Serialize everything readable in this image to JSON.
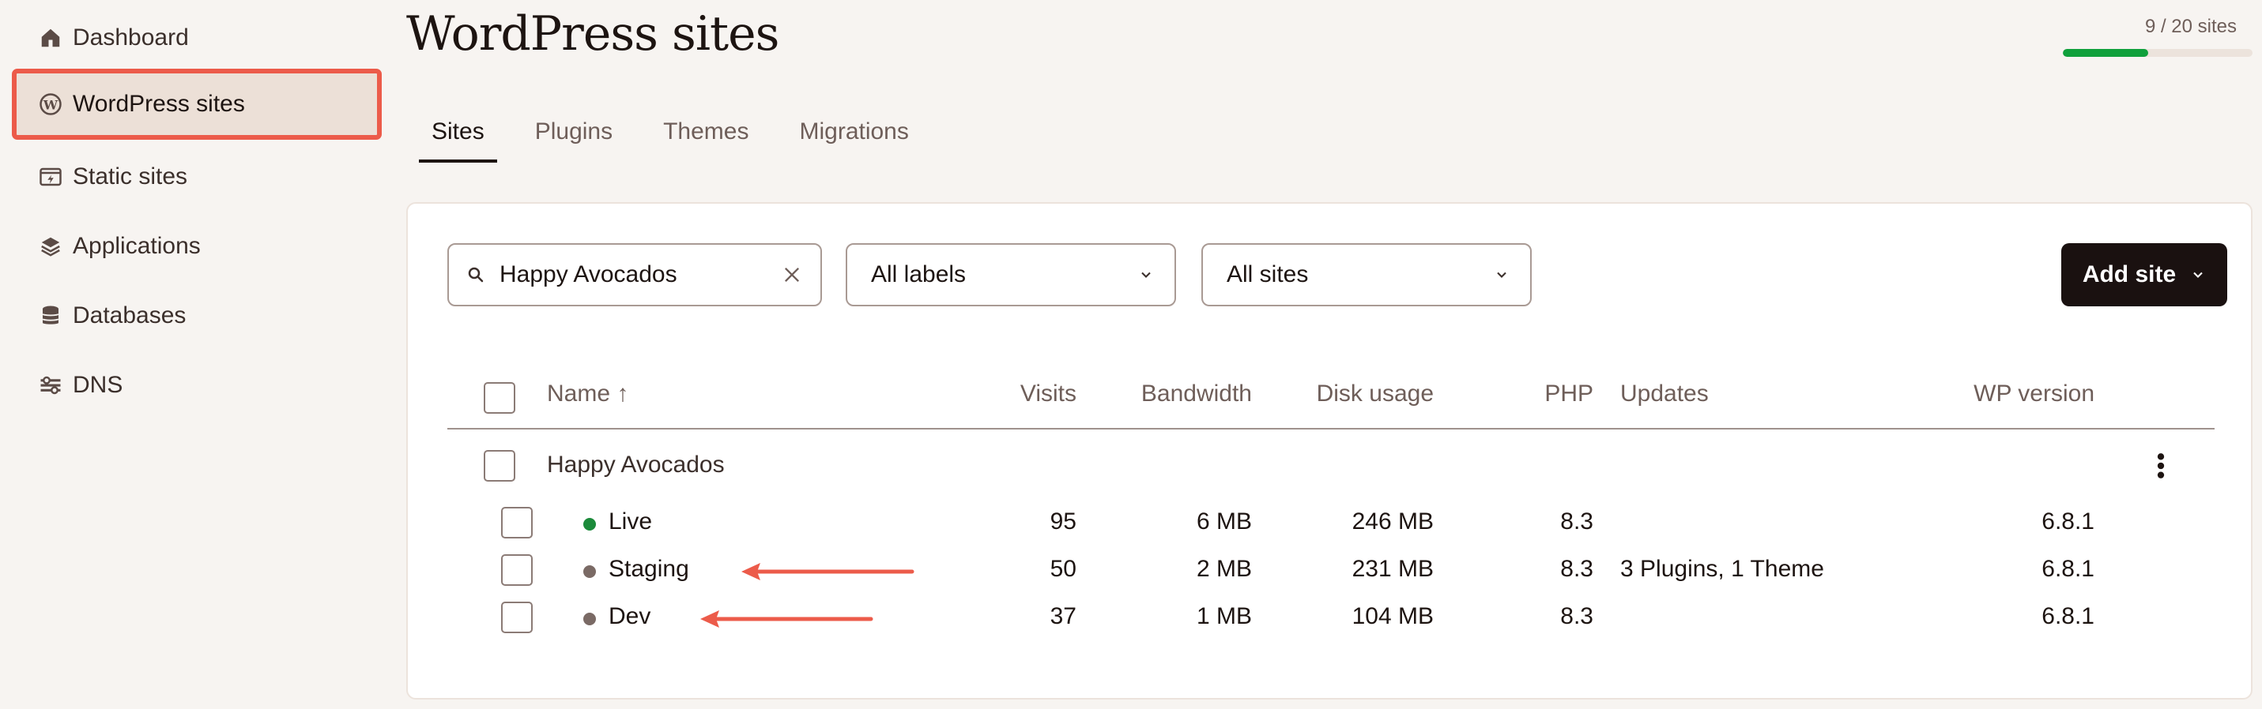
{
  "sidebar": {
    "items": [
      {
        "label": "Dashboard",
        "icon": "home-icon"
      },
      {
        "label": "WordPress sites",
        "icon": "wordpress-icon",
        "active": true
      },
      {
        "label": "Static sites",
        "icon": "static-sites-icon"
      },
      {
        "label": "Applications",
        "icon": "layers-icon"
      },
      {
        "label": "Databases",
        "icon": "database-icon"
      },
      {
        "label": "DNS",
        "icon": "dns-icon"
      }
    ]
  },
  "header": {
    "title": "WordPress sites",
    "usage_text": "9 / 20 sites",
    "usage_fraction": 0.45
  },
  "tabs": [
    {
      "label": "Sites",
      "active": true
    },
    {
      "label": "Plugins"
    },
    {
      "label": "Themes"
    },
    {
      "label": "Migrations"
    }
  ],
  "filters": {
    "search_value": "Happy Avocados",
    "labels_select": "All labels",
    "sites_select": "All sites",
    "add_button": "Add site"
  },
  "table": {
    "columns": {
      "name": "Name ↑",
      "visits": "Visits",
      "bandwidth": "Bandwidth",
      "disk": "Disk usage",
      "php": "PHP",
      "updates": "Updates",
      "wp": "WP version"
    },
    "group": {
      "name": "Happy Avocados",
      "environments": [
        {
          "name": "Live",
          "status_color": "#1b8a3a",
          "visits": "95",
          "bandwidth": "6 MB",
          "disk": "246 MB",
          "php": "8.3",
          "updates": "",
          "wp": "6.8.1"
        },
        {
          "name": "Staging",
          "status_color": "#7a6a65",
          "visits": "50",
          "bandwidth": "2 MB",
          "disk": "231 MB",
          "php": "8.3",
          "updates": "3 Plugins, 1 Theme",
          "wp": "6.8.1"
        },
        {
          "name": "Dev",
          "status_color": "#7a6a65",
          "visits": "37",
          "bandwidth": "1 MB",
          "disk": "104 MB",
          "php": "8.3",
          "updates": "",
          "wp": "6.8.1"
        }
      ]
    }
  },
  "colors": {
    "highlight": "#ec5b4a",
    "progress": "#10a03c",
    "primary_button": "#1a1110"
  }
}
